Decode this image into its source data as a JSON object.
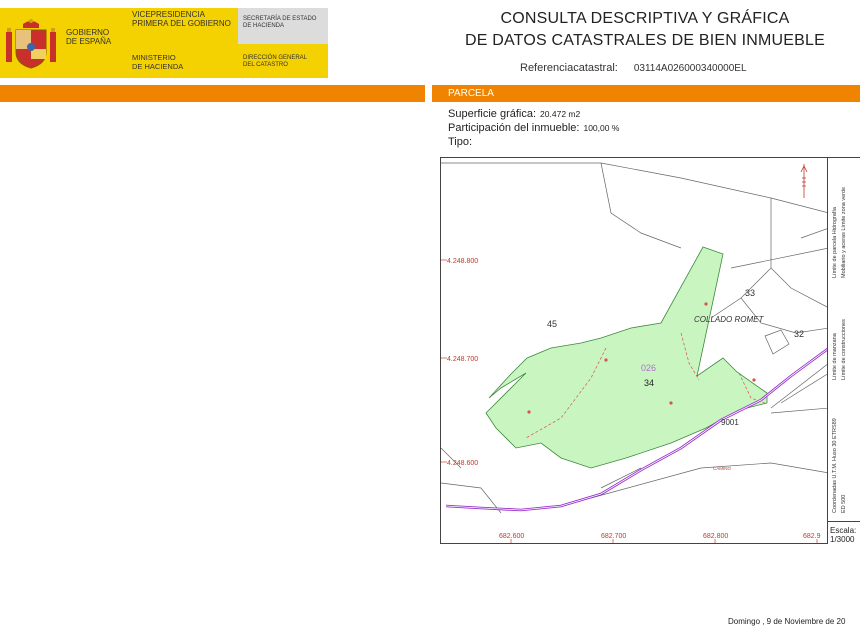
{
  "header": {
    "gov_line1": "GOBIERNO",
    "gov_line2": "DE ESPAÑA",
    "vice_line1": "VICEPRESIDENCIA",
    "vice_line2": "PRIMERA DEL GOBIERNO",
    "ministry_line1": "MINISTERIO",
    "ministry_line2": "DE HACIENDA",
    "secretary_line1": "SECRETARÍA DE ESTADO",
    "secretary_line2": "DE HACIENDA",
    "directorate_line1": "DIRECCIÓN GENERAL",
    "directorate_line2": "DEL CATASTRO",
    "title_line1": "CONSULTA DESCRIPTIVA Y GRÁFICA",
    "title_line2": "DE DATOS CATASTRALES DE BIEN INMUEBLE",
    "ref_label": "Referenciacatastral:",
    "ref_value": "03114A026000340000EL"
  },
  "parcela": {
    "section_label": "PARCELA",
    "surface_label": "Superficie gráfica:",
    "surface_value": "20.472 m2",
    "participation_label": "Participación del inmueble:",
    "participation_value": "100,00 %",
    "type_label": "Tipo:"
  },
  "map": {
    "place_name": "COLLADO ROMET",
    "parcel_code": "026",
    "parcel_number": "34",
    "neighbor_45": "45",
    "neighbor_33": "33",
    "neighbor_32": "32",
    "road_number": "9001",
    "road_label_small": "CAMINO",
    "y_labels": [
      "4.248.800",
      "4.248.700",
      "4.248.600"
    ],
    "x_labels": [
      "682.600",
      "682.700",
      "682.800",
      "682.9"
    ],
    "legend_1": "Límite de parcela  Hidrografía",
    "legend_2": "Mobiliario y aceras  Límite zona verde",
    "legend_3": "Límite de manzana",
    "legend_4": "Límite de construcciones",
    "legend_5": "Coordenadas U.T.M. Huso 30 ETRS89",
    "legend_6": "ED 500",
    "scale_label": "Escala:",
    "scale_value": "1/3000",
    "colors": {
      "parcel_fill": "#c9f5c1",
      "parcel_stroke": "#3c8a3c",
      "road": "#9933cc",
      "grid_label": "#c0392b"
    }
  },
  "footer": {
    "date": "Domingo , 9 de Noviembre de 20"
  }
}
